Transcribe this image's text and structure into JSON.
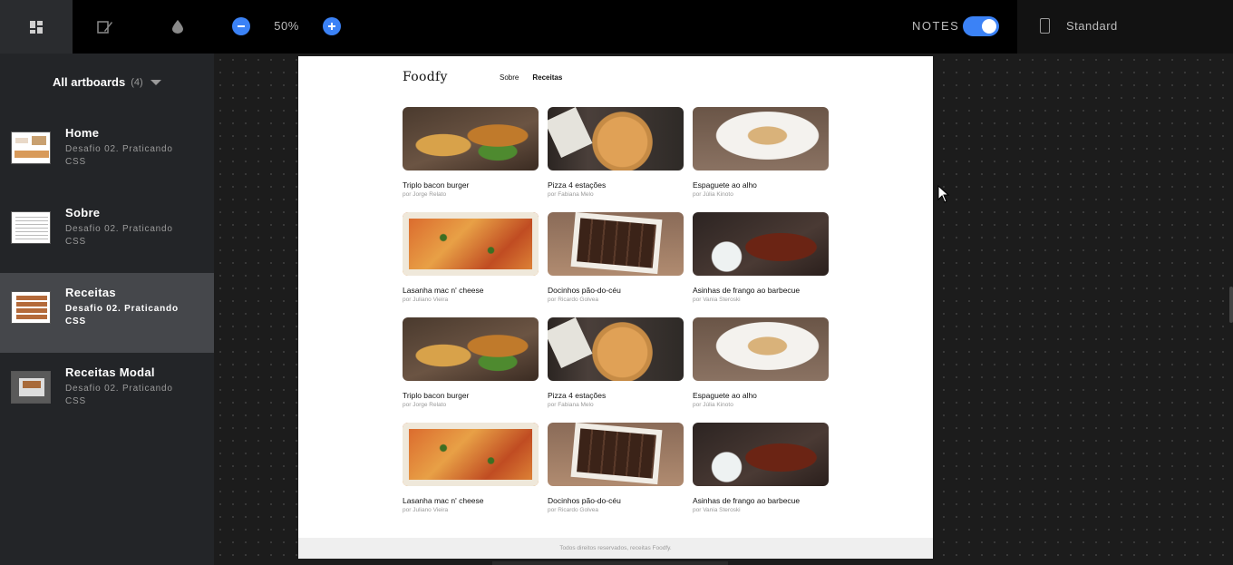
{
  "toolbar": {
    "tabs": [
      "artboards-icon",
      "inspect-icon",
      "colors-icon"
    ],
    "zoom_level": "50%",
    "notes_label": "NOTES",
    "notes_enabled": true,
    "device_label": "Standard",
    "accent_color": "#3b82f6"
  },
  "sidebar": {
    "header_label": "All artboards",
    "header_count": "(4)",
    "items": [
      {
        "title": "Home",
        "subtitle": "Desafio 02. Praticando CSS",
        "active": false
      },
      {
        "title": "Sobre",
        "subtitle": "Desafio 02. Praticando CSS",
        "active": false
      },
      {
        "title": "Receitas",
        "subtitle": "Desafio 02. Praticando CSS",
        "active": true
      },
      {
        "title": "Receitas Modal",
        "subtitle": "Desafio 02. Praticando CSS",
        "active": false
      }
    ]
  },
  "page": {
    "logo": "Foodfy",
    "nav": [
      "Sobre",
      "Receitas"
    ],
    "recipes": [
      {
        "title": "Triplo bacon burger",
        "author": "por Jorge Relato",
        "image": "burger"
      },
      {
        "title": "Pizza 4 estações",
        "author": "por Fabiana Melo",
        "image": "pizza"
      },
      {
        "title": "Espaguete ao alho",
        "author": "por Júlia Kinoto",
        "image": "spaghetti"
      },
      {
        "title": "Lasanha mac n' cheese",
        "author": "por Juliano Vieira",
        "image": "lasagna"
      },
      {
        "title": "Docinhos pão-do-céu",
        "author": "por Ricardo Golvea",
        "image": "docinhos"
      },
      {
        "title": "Asinhas de frango ao barbecue",
        "author": "por Vania Steroski",
        "image": "asinhas"
      },
      {
        "title": "Triplo bacon burger",
        "author": "por Jorge Relato",
        "image": "burger"
      },
      {
        "title": "Pizza 4 estações",
        "author": "por Fabiana Melo",
        "image": "pizza"
      },
      {
        "title": "Espaguete ao alho",
        "author": "por Júlia Kinoto",
        "image": "spaghetti"
      },
      {
        "title": "Lasanha mac n' cheese",
        "author": "por Juliano Vieira",
        "image": "lasagna"
      },
      {
        "title": "Docinhos pão-do-céu",
        "author": "por Ricardo Golvea",
        "image": "docinhos"
      },
      {
        "title": "Asinhas de frango ao barbecue",
        "author": "por Vania Steroski",
        "image": "asinhas"
      }
    ],
    "footer": "Todos direitos reservados, receitas Foodfy."
  }
}
